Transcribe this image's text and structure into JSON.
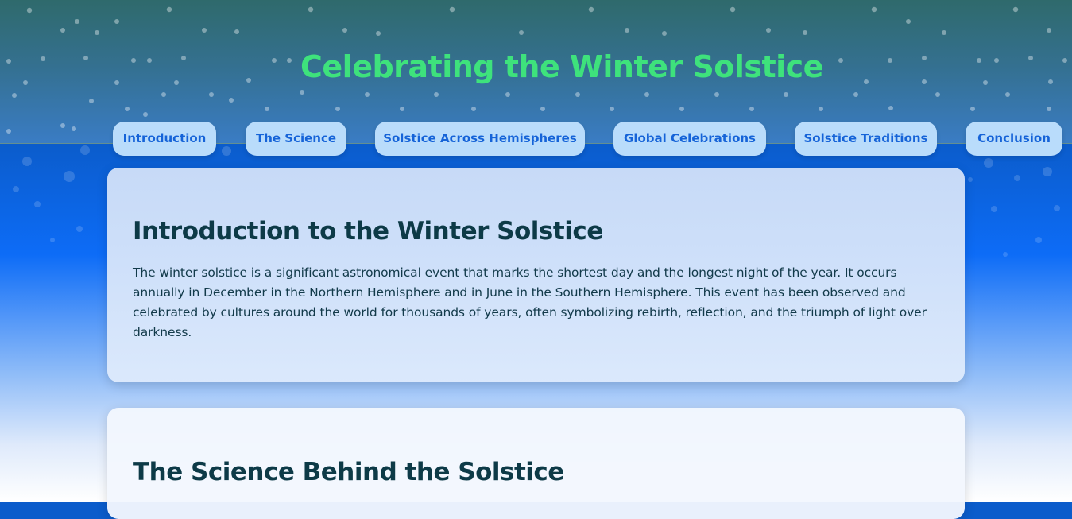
{
  "header": {
    "title": "Celebrating the Winter Solstice"
  },
  "nav": {
    "items": [
      {
        "label": "Introduction"
      },
      {
        "label": "The Science"
      },
      {
        "label": "Solstice Across Hemispheres"
      },
      {
        "label": "Global Celebrations"
      },
      {
        "label": "Solstice Traditions"
      },
      {
        "label": "Conclusion"
      }
    ]
  },
  "sections": [
    {
      "heading": "Introduction to the Winter Solstice",
      "body": "The winter solstice is a significant astronomical event that marks the shortest day and the longest night of the year. It occurs annually in December in the Northern Hemisphere and in June in the Southern Hemisphere. This event has been observed and celebrated by cultures around the world for thousands of years, often symbolizing rebirth, reflection, and the triumph of light over darkness."
    },
    {
      "heading": "The Science Behind the Solstice"
    }
  ],
  "colors": {
    "title": "#3ee27c",
    "nav_button_bg": "#b9dcfb",
    "nav_button_text": "#1563d8",
    "heading": "#0d3a47",
    "header_top": "#2f6a6c",
    "page_blue": "#0d6cf7"
  }
}
